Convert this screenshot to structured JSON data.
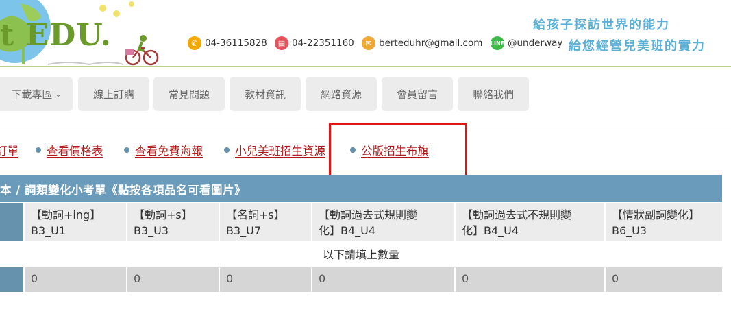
{
  "header": {
    "logo_text": "t EDU.",
    "contacts": [
      {
        "icon": "phone-icon",
        "color": "#f5a800",
        "text": "04-36115828"
      },
      {
        "icon": "fax-icon",
        "color": "#e8505b",
        "text": "04-22351160"
      },
      {
        "icon": "mail-icon",
        "color": "#f0a838",
        "text": "berteduhr@gmail.com"
      },
      {
        "icon": "line-icon",
        "color": "#3dbb4a",
        "text": "@underway"
      }
    ],
    "slogans": [
      "給孩子探訪世界的能力",
      "給您經營兒美班的實力"
    ]
  },
  "nav": {
    "items": [
      "下載專區",
      "線上訂購",
      "常見問題",
      "教材資訊",
      "網路資源",
      "會員留言",
      "聯絡我們"
    ],
    "dropdown_icon": "chevron-down-icon"
  },
  "quick_links": [
    "訂單",
    "查看價格表",
    "查看免費海報",
    "小兒美班招生資源",
    "公版招生布旗"
  ],
  "table": {
    "title": "本 / 詞類變化小考單《點按各項品名可看圖片》",
    "columns": [
      {
        "line1": "【動詞+ing】",
        "line2": "B3_U1"
      },
      {
        "line1": "【動詞+s】",
        "line2": "B3_U3"
      },
      {
        "line1": "【名詞+s】",
        "line2": "B3_U7"
      },
      {
        "line1": "【動詞過去式規則變",
        "line2": "化】B4_U4"
      },
      {
        "line1": "【動詞過去式不規則變",
        "line2": "化】B4_U4"
      },
      {
        "line1": "【情狀副詞變化】",
        "line2": "B6_U3"
      }
    ],
    "fill_note": "以下請填上數量",
    "quantities": [
      "0",
      "0",
      "0",
      "0",
      "0",
      "0"
    ]
  },
  "colors": {
    "accent": "#6792ad",
    "link": "#b01c1c",
    "highlight": "#e01515",
    "logo_green": "#6a9a2a",
    "slogan": "#5bb0d6"
  }
}
